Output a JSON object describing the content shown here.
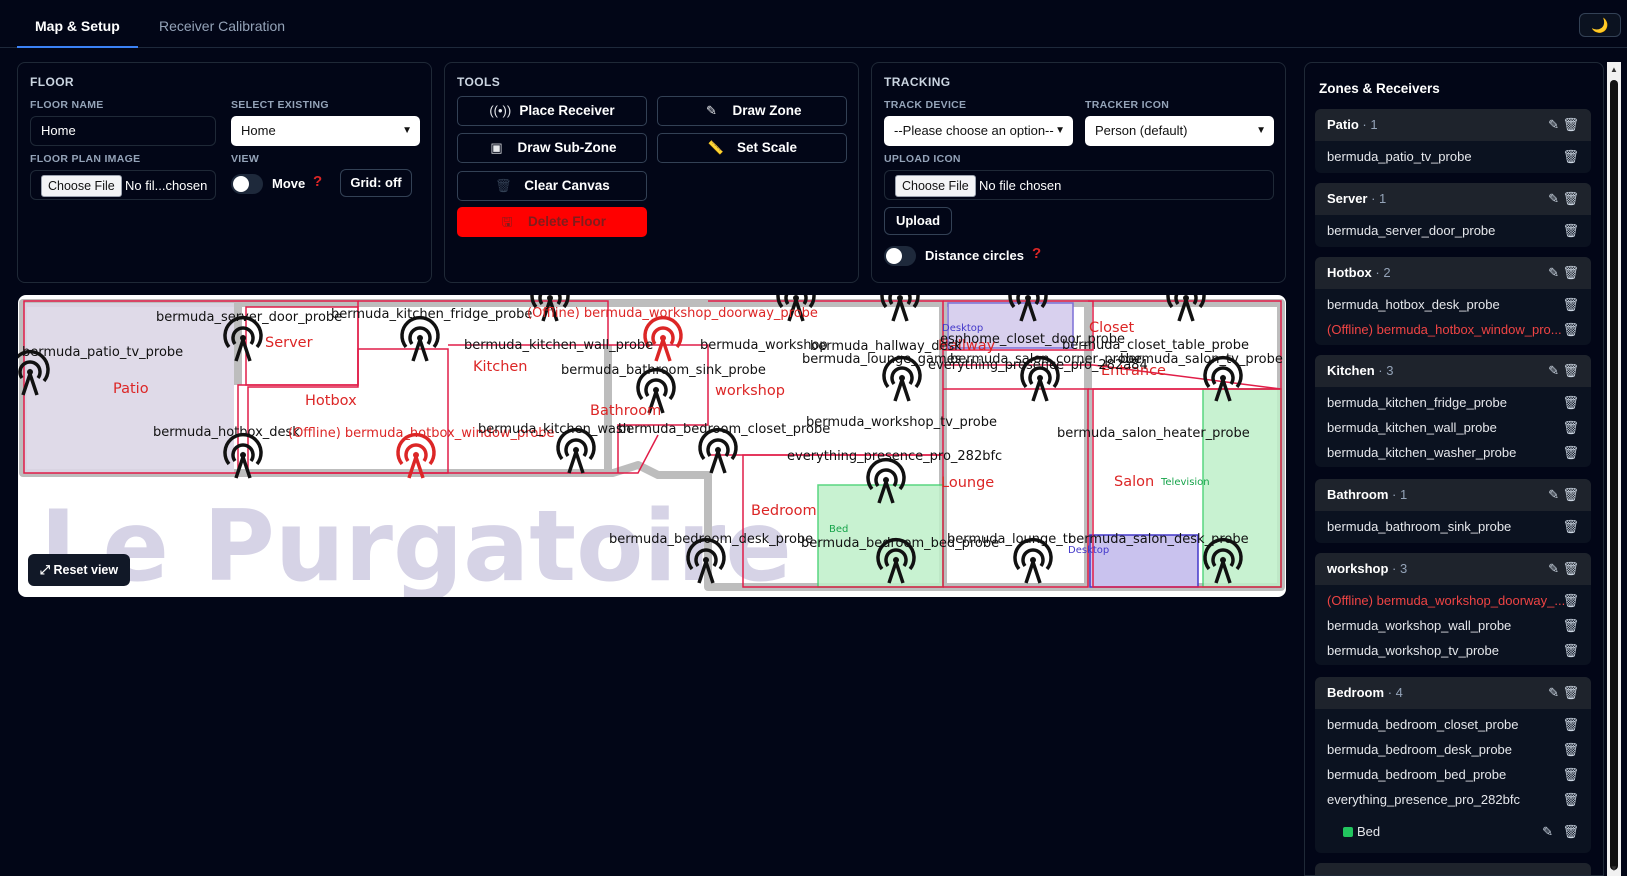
{
  "tabs": [
    {
      "label": "Map & Setup",
      "active": true
    },
    {
      "label": "Receiver Calibration",
      "active": false
    }
  ],
  "theme_toggle": {
    "icon": "moon-icon",
    "glyph": "🌙"
  },
  "floor": {
    "title": "FLOOR",
    "name_label": "FLOOR NAME",
    "name_value": "Home",
    "select_label": "SELECT EXISTING",
    "select_value": "Home",
    "image_label": "FLOOR PLAN IMAGE",
    "file_button": "Choose File",
    "file_status": "No fil...chosen",
    "view_label": "VIEW",
    "move_label": "Move",
    "grid_button": "Grid: off"
  },
  "tools": {
    "title": "TOOLS",
    "place_receiver": "Place Receiver",
    "draw_zone": "Draw Zone",
    "draw_subzone": "Draw Sub-Zone",
    "set_scale": "Set Scale",
    "clear_canvas": "Clear Canvas",
    "delete_floor": "Delete Floor",
    "danger_color": "#ff0000"
  },
  "tracking": {
    "title": "TRACKING",
    "track_label": "TRACK DEVICE",
    "track_value": "--Please choose an option--",
    "icon_label": "TRACKER ICON",
    "icon_value": "Person (default)",
    "upload_label": "UPLOAD ICON",
    "file_button": "Choose File",
    "file_status": "No file chosen",
    "upload_button": "Upload",
    "distance_label": "Distance circles"
  },
  "map": {
    "watermark": "Le Purgatoire",
    "reset_button": "⤢ Reset view",
    "zones": [
      {
        "name": "Patio",
        "color": "#dc2626"
      },
      {
        "name": "Server",
        "color": "#dc2626"
      },
      {
        "name": "Hotbox",
        "color": "#dc2626"
      },
      {
        "name": "Kitchen",
        "color": "#dc2626"
      },
      {
        "name": "Bathroom",
        "color": "#dc2626"
      },
      {
        "name": "workshop",
        "color": "#dc2626"
      },
      {
        "name": "Hallway",
        "color": "#dc2626"
      },
      {
        "name": "Closet",
        "color": "#dc2626"
      },
      {
        "name": "Entrance",
        "color": "#dc2626"
      },
      {
        "name": "Lounge",
        "color": "#dc2626"
      },
      {
        "name": "Salon",
        "color": "#dc2626"
      },
      {
        "name": "Bedroom",
        "color": "#dc2626"
      }
    ],
    "subzones": [
      {
        "name": "Desktop",
        "color": "#4338ca"
      },
      {
        "name": "Television",
        "color": "#16a34a"
      },
      {
        "name": "Bed",
        "color": "#16a34a"
      },
      {
        "name": "Desktop",
        "color": "#4338ca"
      }
    ],
    "receivers": [
      "bermuda_server_door_probe",
      "bermuda_kitchen_fridge_probe",
      "(Offline) bermuda_workshop_doorway_probe",
      "bermuda_patio_tv_probe",
      "bermuda_kitchen_wall_probe",
      "bermuda_workshop",
      "bermuda_hallway_desk",
      "esphome_closet_door_probe",
      "bermuda_closet_table_probe",
      "bermuda_lounge_games",
      "bermuda_salon_corner_probe",
      "bermuda_salon_tv_probe",
      "everything_presence_pro_282a84",
      "bermuda_bathroom_sink_probe",
      "bermuda_hotbox_desk",
      "(Offline) bermuda_hotbox_window_probe",
      "bermuda_kitchen_wash",
      "bermuda_bedroom_closet_probe",
      "bermuda_workshop_tv_probe",
      "bermuda_salon_heater_probe",
      "everything_presence_pro_282bfc",
      "bermuda_bedroom_desk_probe",
      "bermuda_bedroom_bed_probe",
      "bermuda_lounge_tr",
      "bermuda_salon_desk_probe"
    ]
  },
  "sidebar": {
    "title": "Zones & Receivers",
    "groups": [
      {
        "name": "Patio",
        "count": "· 1",
        "items": [
          {
            "label": "bermuda_patio_tv_probe",
            "offline": false
          }
        ]
      },
      {
        "name": "Server",
        "count": "· 1",
        "items": [
          {
            "label": "bermuda_server_door_probe",
            "offline": false
          }
        ]
      },
      {
        "name": "Hotbox",
        "count": "· 2",
        "items": [
          {
            "label": "bermuda_hotbox_desk_probe",
            "offline": false
          },
          {
            "label": "(Offline) bermuda_hotbox_window_pro...",
            "offline": true
          }
        ]
      },
      {
        "name": "Kitchen",
        "count": "· 3",
        "items": [
          {
            "label": "bermuda_kitchen_fridge_probe",
            "offline": false
          },
          {
            "label": "bermuda_kitchen_wall_probe",
            "offline": false
          },
          {
            "label": "bermuda_kitchen_washer_probe",
            "offline": false
          }
        ]
      },
      {
        "name": "Bathroom",
        "count": "· 1",
        "items": [
          {
            "label": "bermuda_bathroom_sink_probe",
            "offline": false
          }
        ]
      },
      {
        "name": "workshop",
        "count": "· 3",
        "items": [
          {
            "label": "(Offline) bermuda_workshop_doorway_...",
            "offline": true
          },
          {
            "label": "bermuda_workshop_wall_probe",
            "offline": false
          },
          {
            "label": "bermuda_workshop_tv_probe",
            "offline": false
          }
        ]
      },
      {
        "name": "Bedroom",
        "count": "· 4",
        "items": [
          {
            "label": "bermuda_bedroom_closet_probe",
            "offline": false
          },
          {
            "label": "bermuda_bedroom_desk_probe",
            "offline": false
          },
          {
            "label": "bermuda_bedroom_bed_probe",
            "offline": false
          },
          {
            "label": "everything_presence_pro_282bfc",
            "offline": false
          }
        ],
        "subzone": {
          "label": "Bed",
          "color": "#22c55e"
        }
      }
    ]
  }
}
